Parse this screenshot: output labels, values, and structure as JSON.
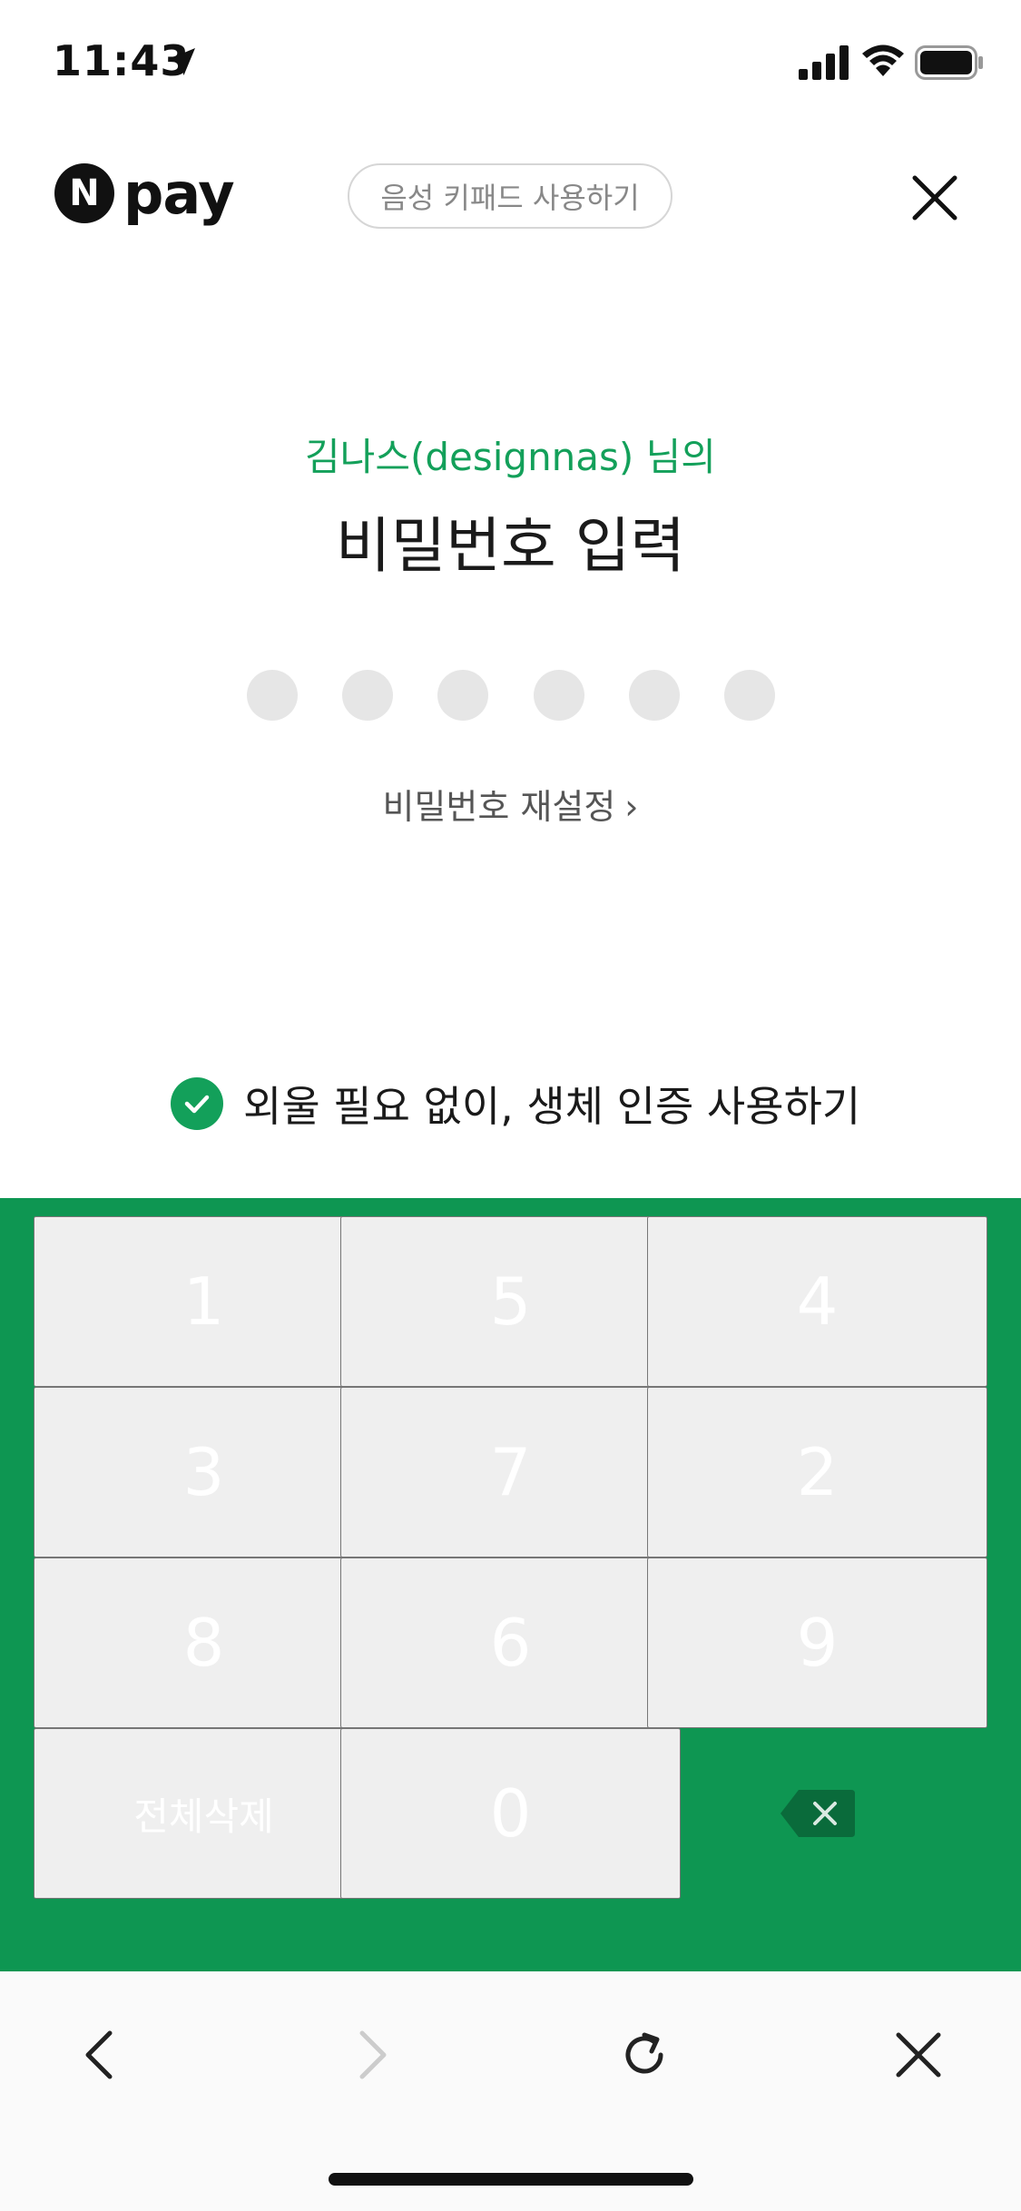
{
  "status_bar": {
    "time": "11:43",
    "icons": [
      "location-arrow-icon",
      "cellular-signal-icon",
      "wifi-icon",
      "battery-icon"
    ]
  },
  "header": {
    "logo_letter": "N",
    "logo_text": "pay",
    "voice_keypad_label": "음성 키패드 사용하기",
    "close_icon": "close-icon"
  },
  "content": {
    "greeting": "김나스(designnas) 님의",
    "title": "비밀번호 입력",
    "pin_length": 6,
    "pin_entered": 0,
    "reset_link": "비밀번호 재설정",
    "reset_chevron": "›",
    "biometric_label": "외울 필요 없이, 생체 인증 사용하기",
    "biometric_checked": true
  },
  "keypad": {
    "keys": [
      "1",
      "5",
      "4",
      "3",
      "7",
      "2",
      "8",
      "6",
      "9"
    ],
    "clear_all_label": "전체삭제",
    "zero": "0",
    "backspace_icon": "backspace-icon"
  },
  "colors": {
    "brand_green": "#13a05a",
    "keypad_bg": "#0e9652",
    "backspace_bg": "#0a6b3b",
    "pin_dot": "#e6e6e6"
  },
  "bottom_bar": {
    "buttons": [
      "back-icon",
      "forward-icon",
      "refresh-icon",
      "close-icon"
    ],
    "forward_enabled": false
  }
}
